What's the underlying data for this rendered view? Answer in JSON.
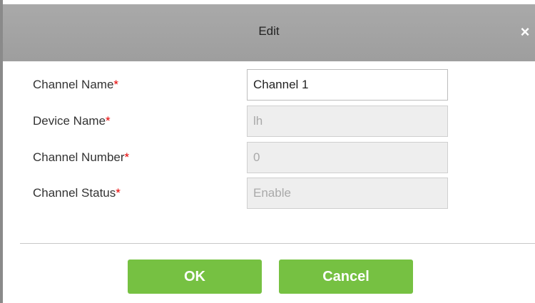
{
  "dialog": {
    "title": "Edit",
    "close_symbol": "×"
  },
  "form": {
    "fields": [
      {
        "label": "Channel Name",
        "required_mark": "*",
        "value": "Channel 1",
        "editable": true
      },
      {
        "label": "Device Name",
        "required_mark": "*",
        "value": "lh",
        "editable": false
      },
      {
        "label": "Channel Number",
        "required_mark": "*",
        "value": "0",
        "editable": false
      },
      {
        "label": "Channel Status",
        "required_mark": "*",
        "value": "Enable",
        "editable": false
      }
    ]
  },
  "footer": {
    "ok_label": "OK",
    "cancel_label": "Cancel"
  },
  "colors": {
    "titlebar": "#a3a3a3",
    "required": "#e60000",
    "button": "#76c142",
    "disabled_field": "#eeeeee"
  },
  "icons": {
    "close": "close-icon"
  }
}
